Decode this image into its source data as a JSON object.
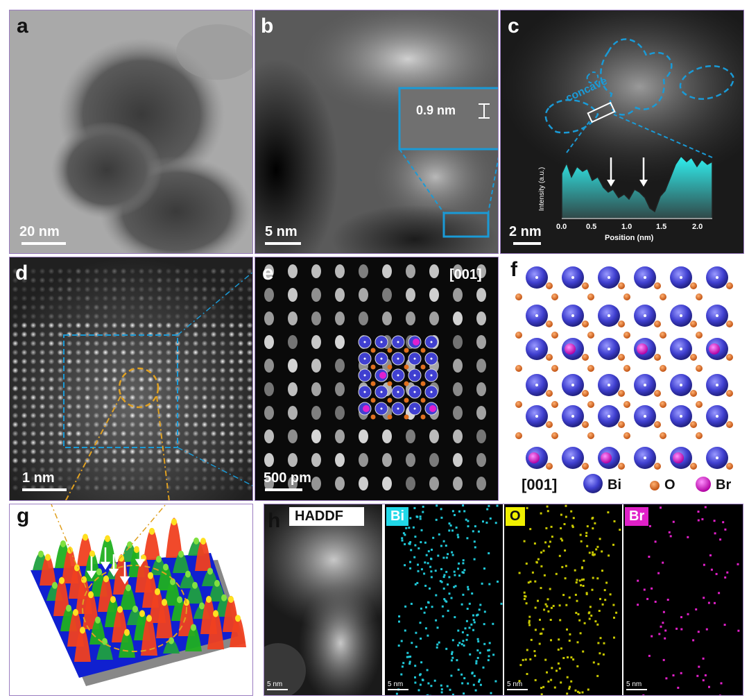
{
  "panel_a": {
    "label": "a",
    "scale": "20 nm"
  },
  "panel_b": {
    "label": "b",
    "scale": "5 nm",
    "inset_measure": "0.9 nm"
  },
  "panel_c": {
    "label": "c",
    "scale": "2 nm",
    "annotation": "concave",
    "profile": {
      "ylabel": "Intensity (a.u.)",
      "xlabel": "Position (nm)",
      "ticks": [
        "0.0",
        "0.5",
        "1.0",
        "1.5",
        "2.0"
      ]
    }
  },
  "panel_d": {
    "label": "d",
    "scale": "1 nm"
  },
  "panel_e": {
    "label": "e",
    "scale": "500 pm",
    "zone": "[001]"
  },
  "panel_f": {
    "label": "f",
    "zone": "[001]",
    "legend": [
      {
        "name": "Bi",
        "color": "#4a4ad8"
      },
      {
        "name": "O",
        "color": "#e07020"
      },
      {
        "name": "Br",
        "color": "#e020d0"
      }
    ]
  },
  "panel_g": {
    "label": "g"
  },
  "panel_h": {
    "label": "h",
    "maps": [
      {
        "name": "HADDF",
        "bg": "#ffffff",
        "fg": "#111111",
        "scale": "5 nm"
      },
      {
        "name": "Bi",
        "bg": "#20d8e8",
        "fg": "#ffffff",
        "scale": "5 nm"
      },
      {
        "name": "O",
        "bg": "#f0f000",
        "fg": "#111111",
        "scale": "5 nm"
      },
      {
        "name": "Br",
        "bg": "#e020c8",
        "fg": "#ffffff",
        "scale": "5 nm"
      }
    ]
  }
}
